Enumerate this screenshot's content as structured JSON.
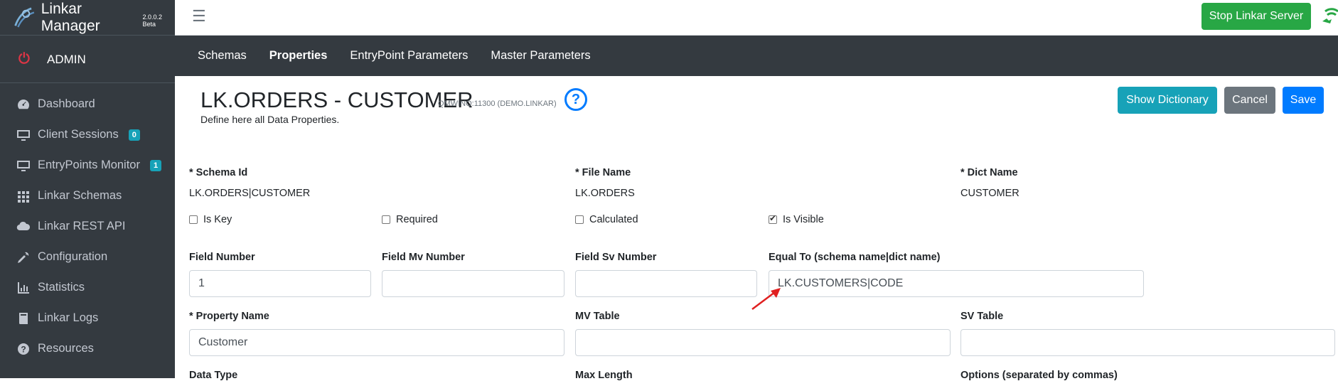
{
  "app": {
    "name": "Linkar Manager",
    "version": "2.0.0.2 Beta"
  },
  "sidebar": {
    "user": "ADMIN",
    "items": [
      {
        "label": "Dashboard",
        "icon": "dashboard-icon"
      },
      {
        "label": "Client Sessions",
        "icon": "monitor-icon",
        "badge": "0"
      },
      {
        "label": "EntryPoints Monitor",
        "icon": "monitor-icon",
        "badge": "1"
      },
      {
        "label": "Linkar Schemas",
        "icon": "grid-icon"
      },
      {
        "label": "Linkar REST API",
        "icon": "cloud-icon"
      },
      {
        "label": "Configuration",
        "icon": "tools-icon"
      },
      {
        "label": "Statistics",
        "icon": "chart-icon"
      },
      {
        "label": "Linkar Logs",
        "icon": "book-icon"
      },
      {
        "label": "Resources",
        "icon": "question-icon"
      }
    ]
  },
  "topbar": {
    "stop_label": "Stop Linkar Server"
  },
  "subnav": {
    "items": [
      "Schemas",
      "Properties",
      "EntryPoint Parameters",
      "Master Parameters"
    ],
    "active": "Properties"
  },
  "page": {
    "title": "LK.ORDERS - CUSTOMER",
    "subtitle": "QMWINQ:11300 (DEMO.LINKAR)",
    "description": "Define here all Data Properties."
  },
  "actions": {
    "show_dictionary": "Show Dictionary",
    "cancel": "Cancel",
    "save": "Save"
  },
  "form": {
    "schema_id_label": "* Schema Id",
    "schema_id_value": "LK.ORDERS|CUSTOMER",
    "file_name_label": "* File Name",
    "file_name_value": "LK.ORDERS",
    "dict_name_label": "* Dict Name",
    "dict_name_value": "CUSTOMER",
    "is_key_label": "Is Key",
    "required_label": "Required",
    "calculated_label": "Calculated",
    "is_visible_label": "Is Visible",
    "is_visible_checked": true,
    "field_number_label": "Field Number",
    "field_number_value": "1",
    "field_mv_label": "Field Mv Number",
    "field_mv_value": "",
    "field_sv_label": "Field Sv Number",
    "field_sv_value": "",
    "equal_to_label": "Equal To (schema name|dict name)",
    "equal_to_value": "LK.CUSTOMERS|CODE",
    "property_name_label": "* Property Name",
    "property_name_value": "Customer",
    "mv_table_label": "MV Table",
    "mv_table_value": "",
    "sv_table_label": "SV Table",
    "sv_table_value": "",
    "data_type_label": "Data Type",
    "max_length_label": "Max Length",
    "options_label": "Options (separated by commas)"
  },
  "colors": {
    "sidebar": "#343a40",
    "success": "#28a745",
    "info": "#17a2b8",
    "primary": "#007bff",
    "secondary": "#6c757d",
    "annotation": "#e02020"
  }
}
